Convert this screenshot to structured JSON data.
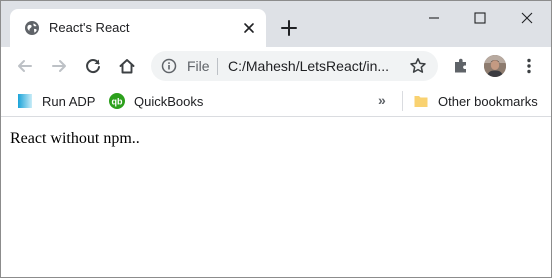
{
  "tab": {
    "title": "React's React",
    "favicon": "globe-icon"
  },
  "window_controls": [
    "minimize-icon",
    "maximize-icon",
    "close-icon"
  ],
  "toolbar": {
    "back": "back-arrow-icon",
    "forward": "forward-arrow-icon",
    "reload": "reload-icon",
    "home": "home-icon",
    "extensions": "puzzle-icon",
    "menu": "kebab-menu-icon"
  },
  "omnibox": {
    "scheme_label": "File",
    "url": "C:/Mahesh/LetsReact/in..."
  },
  "bookmarks": {
    "items": [
      {
        "label": "Run ADP",
        "icon": "adp-icon"
      },
      {
        "label": "QuickBooks",
        "icon": "quickbooks-icon"
      }
    ],
    "overflow": "»",
    "other_label": "Other bookmarks"
  },
  "page": {
    "body_text": "React without npm.."
  },
  "colors": {
    "tabstrip": "#dee1e6",
    "omnibox": "#f1f3f4",
    "icon": "#5f6368",
    "quickbooks_green": "#2ca01c",
    "folder_yellow": "#f9d271"
  }
}
